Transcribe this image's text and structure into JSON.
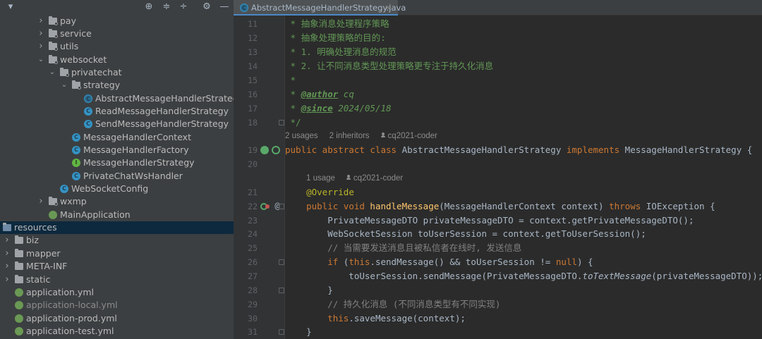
{
  "project_tree": {
    "toolbar_icons": [
      "chevron-down-icon",
      "locate-icon",
      "expand-all-icon",
      "collapse-all-icon",
      "gear-icon",
      "hide-icon"
    ],
    "rows": [
      {
        "label": "pay",
        "kind": "package",
        "arrow": "right",
        "indent": 0
      },
      {
        "label": "service",
        "kind": "package",
        "arrow": "right",
        "indent": 0
      },
      {
        "label": "utils",
        "kind": "package",
        "arrow": "right",
        "indent": 0
      },
      {
        "label": "websocket",
        "kind": "package",
        "arrow": "down",
        "indent": 0
      },
      {
        "label": "privatechat",
        "kind": "package",
        "arrow": "down",
        "indent": 1
      },
      {
        "label": "strategy",
        "kind": "package",
        "arrow": "down",
        "indent": 2
      },
      {
        "label": "AbstractMessageHandlerStrategy",
        "kind": "abstract-class",
        "arrow": "",
        "indent": 3
      },
      {
        "label": "ReadMessageHandlerStrategy",
        "kind": "class",
        "arrow": "",
        "indent": 3
      },
      {
        "label": "SendMessageHandlerStrategy",
        "kind": "class",
        "arrow": "",
        "indent": 3
      },
      {
        "label": "MessageHandlerContext",
        "kind": "class",
        "arrow": "",
        "indent": 2
      },
      {
        "label": "MessageHandlerFactory",
        "kind": "class",
        "arrow": "",
        "indent": 2
      },
      {
        "label": "MessageHandlerStrategy",
        "kind": "interface",
        "arrow": "",
        "indent": 2
      },
      {
        "label": "PrivateChatWsHandler",
        "kind": "class",
        "arrow": "",
        "indent": 2
      },
      {
        "label": "WebSocketConfig",
        "kind": "class",
        "arrow": "",
        "indent": 1
      },
      {
        "label": "wxmp",
        "kind": "package",
        "arrow": "right",
        "indent": 0
      },
      {
        "label": "MainApplication",
        "kind": "spring-class",
        "arrow": "",
        "indent": 0
      },
      {
        "label": "resources",
        "kind": "resources-folder",
        "arrow": "",
        "indent": -3,
        "selected": true
      },
      {
        "label": "biz",
        "kind": "folder",
        "arrow": "right",
        "indent": -2
      },
      {
        "label": "mapper",
        "kind": "folder",
        "arrow": "right",
        "indent": -2
      },
      {
        "label": "META-INF",
        "kind": "folder",
        "arrow": "right",
        "indent": -2
      },
      {
        "label": "static",
        "kind": "folder",
        "arrow": "right",
        "indent": -2
      },
      {
        "label": "application.yml",
        "kind": "yml",
        "arrow": "",
        "indent": -1
      },
      {
        "label": "application-local.yml",
        "kind": "yml",
        "arrow": "",
        "indent": -1,
        "dim": true
      },
      {
        "label": "application-prod.yml",
        "kind": "yml",
        "arrow": "",
        "indent": -1
      },
      {
        "label": "application-test.yml",
        "kind": "yml",
        "arrow": "",
        "indent": -1
      }
    ]
  },
  "editor": {
    "tab": {
      "label": "AbstractMessageHandlerStrategy.java",
      "close": "×"
    },
    "hints": {
      "class_usages": "2 usages",
      "class_inheritors": "2 inheritors",
      "class_author": "cq2021-coder",
      "method_usages": "1 usage",
      "method_author": "cq2021-coder"
    },
    "lines": [
      {
        "no": "11",
        "segments": [
          [
            " * ",
            "doc"
          ],
          [
            "抽象消息处理程序策略",
            "doc"
          ]
        ]
      },
      {
        "no": "12",
        "segments": [
          [
            " * ",
            "doc"
          ],
          [
            "抽象处理策略的目的:",
            "doc"
          ]
        ]
      },
      {
        "no": "13",
        "segments": [
          [
            " * 1. 明确处理消息的规范",
            "doc"
          ]
        ]
      },
      {
        "no": "14",
        "segments": [
          [
            " * 2. 让不同消息类型处理策略更专注于持久化消息",
            "doc"
          ]
        ]
      },
      {
        "no": "15",
        "segments": [
          [
            " *",
            "doc"
          ]
        ]
      },
      {
        "no": "16",
        "segments": [
          [
            " * ",
            "doc"
          ],
          [
            "@author",
            "docbold"
          ],
          [
            " cq",
            "doctext"
          ]
        ]
      },
      {
        "no": "17",
        "segments": [
          [
            " * ",
            "doc"
          ],
          [
            "@since",
            "docbold"
          ],
          [
            " 2024/05/18",
            "doctext"
          ]
        ]
      },
      {
        "no": "18",
        "segments": [
          [
            " */",
            "doc"
          ]
        ]
      },
      {
        "no": "19",
        "segments": [
          [
            "public abstract class ",
            "kw"
          ],
          [
            "AbstractMessageHandlerStrategy ",
            "text"
          ],
          [
            "implements ",
            "kw"
          ],
          [
            "MessageHandlerStrategy {",
            "text"
          ]
        ]
      },
      {
        "no": "20",
        "segments": []
      },
      {
        "no": "21",
        "segments": [
          [
            "    ",
            "text"
          ],
          [
            "@Override",
            "ann"
          ]
        ]
      },
      {
        "no": "22",
        "segments": [
          [
            "    ",
            "text"
          ],
          [
            "public void ",
            "kw"
          ],
          [
            "handleMessage",
            "fn"
          ],
          [
            "(MessageHandlerContext context) ",
            "text"
          ],
          [
            "throws ",
            "kw"
          ],
          [
            "IOException {",
            "text"
          ]
        ]
      },
      {
        "no": "23",
        "segments": [
          [
            "        PrivateMessageDTO privateMessageDTO = context.getPrivateMessageDTO();",
            "text"
          ]
        ]
      },
      {
        "no": "24",
        "segments": [
          [
            "        WebSocketSession toUserSession = context.getToUserSession();",
            "text"
          ]
        ]
      },
      {
        "no": "25",
        "segments": [
          [
            "        ",
            "text"
          ],
          [
            "// 当需要发送消息且被私信者在线时, 发送信息",
            "cmt"
          ]
        ]
      },
      {
        "no": "26",
        "segments": [
          [
            "        ",
            "text"
          ],
          [
            "if ",
            "kw"
          ],
          [
            "(",
            "text"
          ],
          [
            "this",
            "kw"
          ],
          [
            ".sendMessage() && toUserSession != ",
            "text"
          ],
          [
            "null",
            "kw"
          ],
          [
            ") {",
            "text"
          ]
        ]
      },
      {
        "no": "27",
        "segments": [
          [
            "            toUserSession.sendMessage(PrivateMessageDTO.",
            "text"
          ],
          [
            "toTextMessage",
            "it"
          ],
          [
            "(privateMessageDTO));",
            "text"
          ]
        ]
      },
      {
        "no": "28",
        "segments": [
          [
            "        }",
            "text"
          ]
        ]
      },
      {
        "no": "29",
        "segments": [
          [
            "        ",
            "text"
          ],
          [
            "// 持久化消息 (不同消息类型有不同实现)",
            "cmt"
          ]
        ]
      },
      {
        "no": "30",
        "segments": [
          [
            "        ",
            "text"
          ],
          [
            "this",
            "kw"
          ],
          [
            ".saveMessage(context);",
            "text"
          ]
        ]
      },
      {
        "no": "31",
        "segments": [
          [
            "    }",
            "text"
          ]
        ]
      }
    ]
  },
  "colors": {
    "panel_bg": "#3c3f41",
    "editor_bg": "#2b2b2b",
    "selection": "#0d293e",
    "keyword": "#cc7832",
    "doc_comment": "#629755",
    "annotation": "#bbb529",
    "method": "#ffc66d",
    "comment": "#808080"
  }
}
